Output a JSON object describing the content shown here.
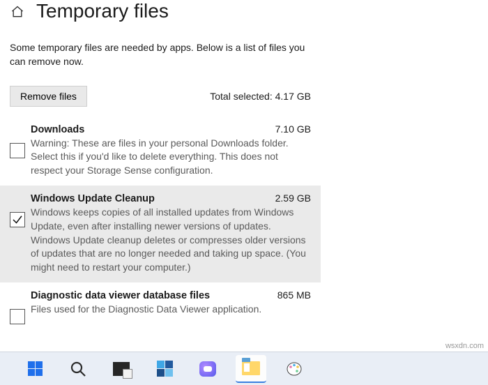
{
  "header": {
    "title": "Temporary files"
  },
  "intro": "Some temporary files are needed by apps. Below is a list of files you can remove now.",
  "actions": {
    "remove_label": "Remove files",
    "total_selected_label": "Total selected: 4.17 GB"
  },
  "items": [
    {
      "title": "Downloads",
      "size": "7.10 GB",
      "desc": "Warning: These are files in your personal Downloads folder. Select this if you'd like to delete everything. This does not respect your Storage Sense configuration.",
      "checked": false
    },
    {
      "title": "Windows Update Cleanup",
      "size": "2.59 GB",
      "desc": "Windows keeps copies of all installed updates from Windows Update, even after installing newer versions of updates. Windows Update cleanup deletes or compresses older versions of updates that are no longer needed and taking up space. (You might need to restart your computer.)",
      "checked": true
    },
    {
      "title": "Diagnostic data viewer database files",
      "size": "865 MB",
      "desc": "Files used for the Diagnostic Data Viewer application.",
      "checked": false
    }
  ],
  "watermark": "wsxdn.com"
}
